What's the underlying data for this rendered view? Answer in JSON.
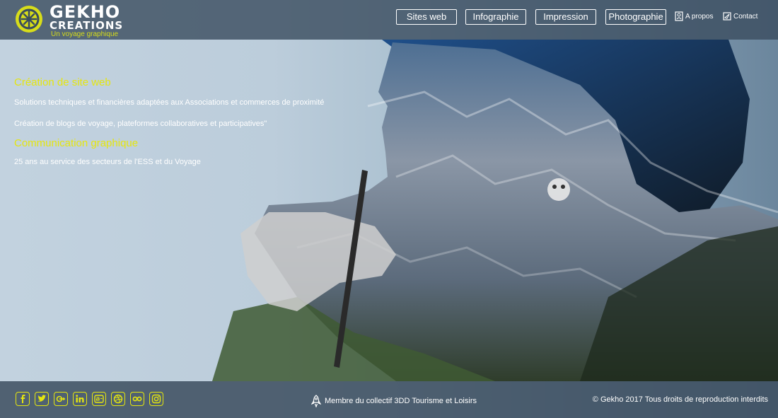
{
  "brand": {
    "name_line1": "GEKHO",
    "name_line2": "CREATIONS",
    "tagline": "Un voyage graphique",
    "accent_color": "#d7dd1a"
  },
  "nav": {
    "buttons": [
      "Sites web",
      "Infographie",
      "Impression",
      "Photographie"
    ],
    "about": "A propos",
    "contact": "Contact"
  },
  "intro": {
    "heading1": "Création de site web",
    "line1": "Solutions techniques et financières adaptées aux Associations et commerces de proximité",
    "line2": "Création de blogs de voyage, plateformes collaboratives et participatives\"",
    "heading2": "Communication graphique",
    "line3": "25 ans au service des secteurs de l'ESS et du Voyage"
  },
  "footer": {
    "social_icons": [
      "facebook-icon",
      "twitter-icon",
      "google-plus-icon",
      "linkedin-icon",
      "behance-icon",
      "dribbble-icon",
      "flickr-icon",
      "instagram-icon"
    ],
    "member_text": "Membre du collectif 3DD Tourisme et Loisirs",
    "copyright": "© Gekho 2017 Tous droits de reproduction interdits"
  }
}
